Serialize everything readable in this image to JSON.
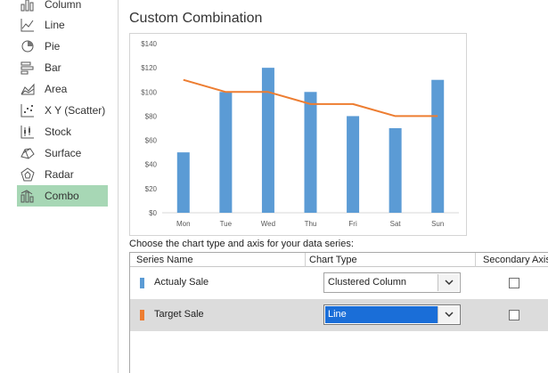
{
  "sidebar": {
    "items": [
      {
        "label": "Column",
        "icon": "column-chart-icon",
        "selected": false
      },
      {
        "label": "Line",
        "icon": "line-chart-icon",
        "selected": false
      },
      {
        "label": "Pie",
        "icon": "pie-chart-icon",
        "selected": false
      },
      {
        "label": "Bar",
        "icon": "bar-chart-icon",
        "selected": false
      },
      {
        "label": "Area",
        "icon": "area-chart-icon",
        "selected": false
      },
      {
        "label": "X Y (Scatter)",
        "icon": "scatter-chart-icon",
        "selected": false
      },
      {
        "label": "Stock",
        "icon": "stock-chart-icon",
        "selected": false
      },
      {
        "label": "Surface",
        "icon": "surface-chart-icon",
        "selected": false
      },
      {
        "label": "Radar",
        "icon": "radar-chart-icon",
        "selected": false
      },
      {
        "label": "Combo",
        "icon": "combo-chart-icon",
        "selected": true
      }
    ]
  },
  "panel": {
    "title": "Custom Combination",
    "series_prompt": "Choose the chart type and axis for your data series:"
  },
  "grid": {
    "headers": {
      "series_name": "Series Name",
      "chart_type": "Chart Type",
      "secondary_axis": "Secondary Axis"
    },
    "rows": [
      {
        "name": "Actualy Sale",
        "color": "#5b9bd5",
        "chart_type": "Clustered Column",
        "secondary_axis": false,
        "highlighted": false
      },
      {
        "name": "Target Sale",
        "color": "#ed7d31",
        "chart_type": "Line",
        "secondary_axis": false,
        "highlighted": true
      }
    ]
  },
  "chart_data": {
    "type": "bar",
    "categories": [
      "Mon",
      "Tue",
      "Wed",
      "Thu",
      "Fri",
      "Sat",
      "Sun"
    ],
    "series": [
      {
        "name": "Actualy Sale",
        "type": "bar",
        "color": "#5b9bd5",
        "values": [
          50,
          100,
          120,
          100,
          80,
          70,
          110
        ]
      },
      {
        "name": "Target Sale",
        "type": "line",
        "color": "#ed7d31",
        "values": [
          110,
          100,
          100,
          90,
          90,
          80,
          80
        ]
      }
    ],
    "ylim": [
      0,
      140
    ],
    "yticks": [
      "$0",
      "$20",
      "$40",
      "$60",
      "$80",
      "$100",
      "$120",
      "$140"
    ],
    "title": "",
    "xlabel": "",
    "ylabel": "",
    "grid": false,
    "legend": "none"
  }
}
